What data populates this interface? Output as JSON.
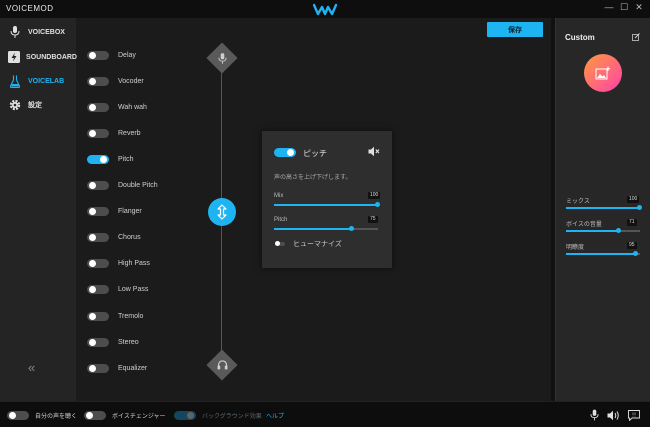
{
  "titlebar": {
    "app_title": "VOICEMOD",
    "minimize": "—",
    "maximize": "☐",
    "close": "✕"
  },
  "sidebar": {
    "items": [
      {
        "label": "VOICEBOX",
        "icon": "microphone-icon",
        "active": false
      },
      {
        "label": "SOUNDBOARD",
        "icon": "lightning-icon",
        "active": false
      },
      {
        "label": "VOICELAB",
        "icon": "flask-icon",
        "active": true
      },
      {
        "label": "設定",
        "icon": "gear-icon",
        "active": false
      }
    ],
    "collapse_label": "«"
  },
  "main": {
    "save_label": "保存",
    "effects": [
      {
        "name": "Delay",
        "on": false
      },
      {
        "name": "Vocoder",
        "on": false
      },
      {
        "name": "Wah wah",
        "on": false
      },
      {
        "name": "Reverb",
        "on": false
      },
      {
        "name": "Pitch",
        "on": true
      },
      {
        "name": "Double Pitch",
        "on": false
      },
      {
        "name": "Flanger",
        "on": false
      },
      {
        "name": "Chorus",
        "on": false
      },
      {
        "name": "High Pass",
        "on": false
      },
      {
        "name": "Low Pass",
        "on": false
      },
      {
        "name": "Tremolo",
        "on": false
      },
      {
        "name": "Stereo",
        "on": false
      },
      {
        "name": "Equalizer",
        "on": false
      }
    ]
  },
  "popup": {
    "title": "ピッチ",
    "enabled": true,
    "description": "声の高さを上げ下げします。",
    "sliders": [
      {
        "label": "Mix",
        "value": "100",
        "fraction": 1.0
      },
      {
        "label": "Pitch",
        "value": "75",
        "fraction": 0.75
      }
    ],
    "humanize_label": "ヒューマナイズ"
  },
  "right_panel": {
    "title": "Custom",
    "sliders": [
      {
        "label": "ミックス",
        "value": "100",
        "fraction": 1.0
      },
      {
        "label": "ボイスの音量",
        "value": "71",
        "fraction": 0.71
      },
      {
        "label": "明瞭度",
        "value": "95",
        "fraction": 0.95
      }
    ]
  },
  "bottombar": {
    "hear_myself": "自分の声を聴く",
    "voice_changer": "ボイスチェンジャー",
    "background_effects": "バックグラウンド効果",
    "help": "ヘルプ"
  },
  "colors": {
    "accent": "#1eb4f2",
    "background": "#1b1b1b",
    "sidebar": "#242424"
  }
}
